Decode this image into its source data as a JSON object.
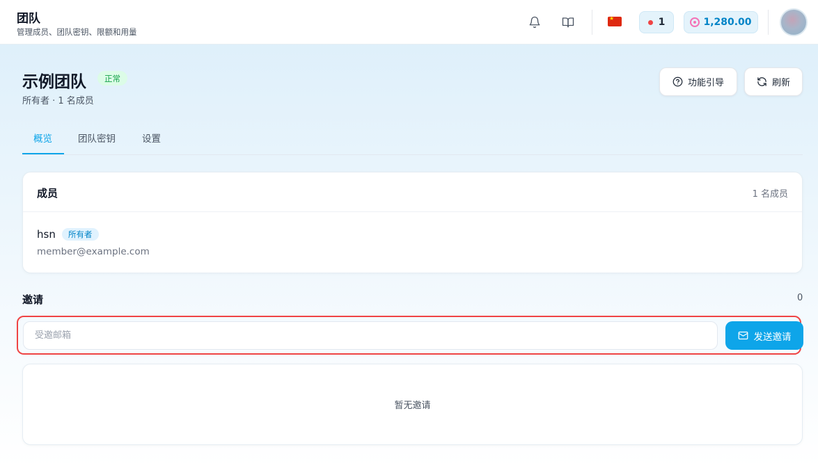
{
  "header": {
    "title": "团队",
    "subtitle": "管理成员、团队密钥、限额和用量",
    "icons": [
      "bell-icon",
      "book-icon"
    ],
    "language_flag": "china-flag-icon",
    "status_count": "1",
    "balance": "1,280.00"
  },
  "team": {
    "name": "示例团队",
    "status": "正常",
    "meta": "所有者 · 1 名成员"
  },
  "actions": {
    "guide_label": "功能引导",
    "refresh_label": "刷新"
  },
  "tabs": [
    {
      "label": "概览",
      "active": true
    },
    {
      "label": "团队密钥",
      "active": false
    },
    {
      "label": "设置",
      "active": false
    }
  ],
  "members": {
    "title": "成员",
    "count": "1 名成员",
    "items": [
      {
        "name": "hsn",
        "role": "所有者",
        "email": "member@example.com"
      }
    ]
  },
  "invites": {
    "title": "邀请",
    "count": "0",
    "input_placeholder": "受邀邮箱",
    "input_value": "",
    "send_label": "发送邀请",
    "empty_text": "暂无邀请"
  },
  "colors": {
    "accent": "#0ea5e9",
    "status_green": "#16a34a",
    "highlight_red": "#ef4444"
  }
}
